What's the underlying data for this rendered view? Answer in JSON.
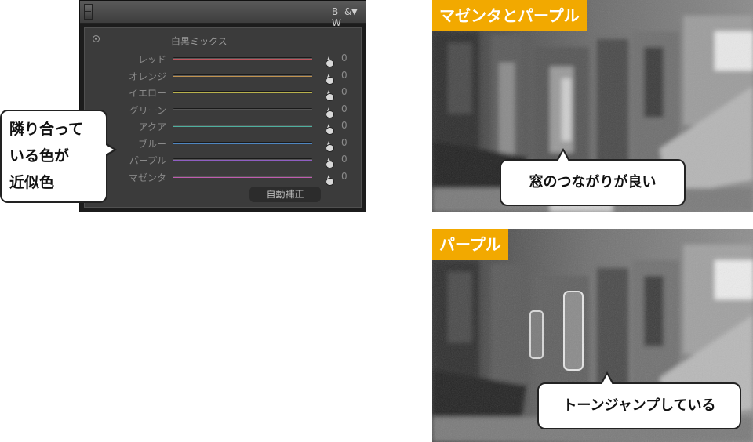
{
  "panel": {
    "title": "B & W",
    "subtitle": "白黒ミックス",
    "auto_button": "自動補正",
    "sliders": [
      {
        "label": "レッド",
        "value": "0",
        "color": "#c0555d"
      },
      {
        "label": "オレンジ",
        "value": "0",
        "color": "#c0924e"
      },
      {
        "label": "イエロー",
        "value": "0",
        "color": "#b8b14c"
      },
      {
        "label": "グリーン",
        "value": "0",
        "color": "#57a45a"
      },
      {
        "label": "アクア",
        "value": "0",
        "color": "#4eb09e"
      },
      {
        "label": "ブルー",
        "value": "0",
        "color": "#4f86c0"
      },
      {
        "label": "パープル",
        "value": "0",
        "color": "#8f5ec2"
      },
      {
        "label": "マゼンタ",
        "value": "0",
        "color": "#c05bb0"
      }
    ]
  },
  "callout_left": {
    "lines": [
      "隣り合って",
      "いる色が",
      "近似色"
    ]
  },
  "photo_top": {
    "label": "マゼンタとパープル",
    "callout": "窓のつながりが良い"
  },
  "photo_bottom": {
    "label": "パープル",
    "callout": "トーンジャンプしている"
  },
  "colors": {
    "label_bg": "#f2a900",
    "panel_bg": "#3b3b3b"
  }
}
